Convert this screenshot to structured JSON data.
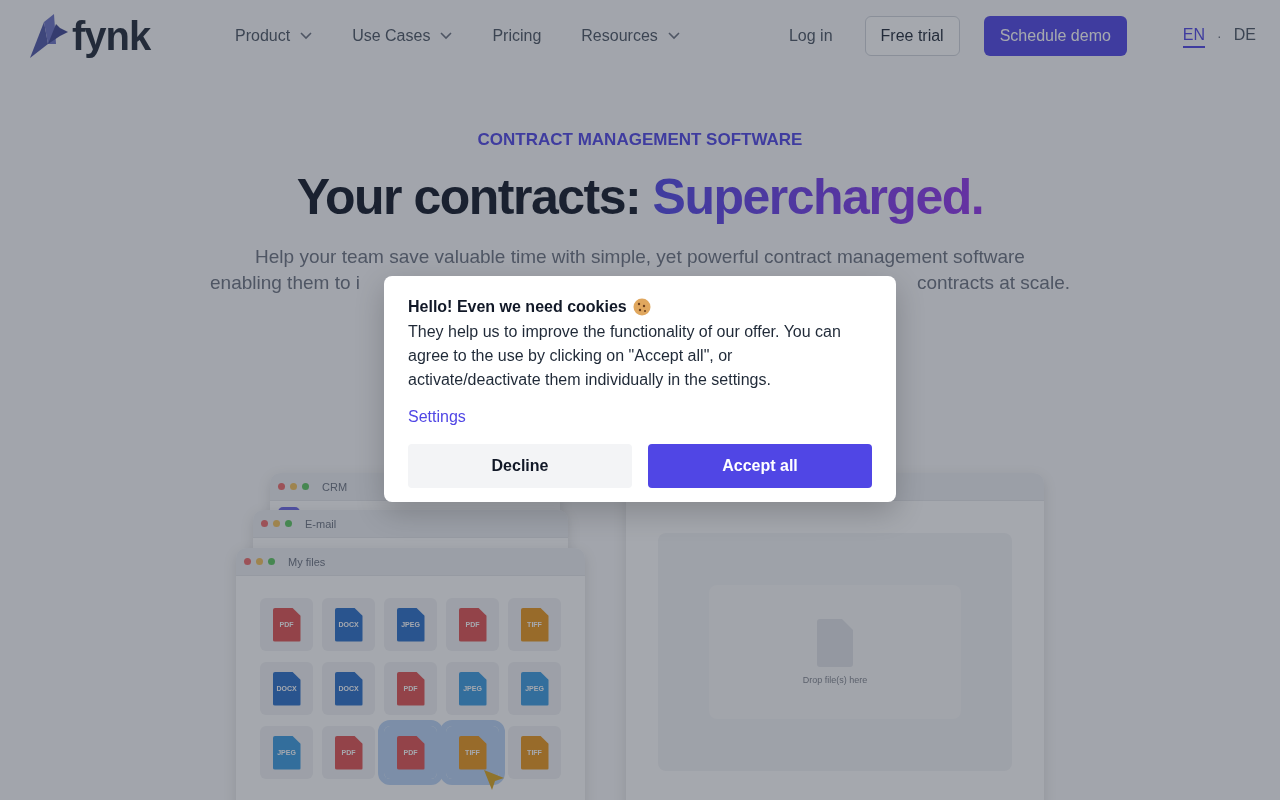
{
  "header": {
    "logo": "fynk",
    "nav": [
      {
        "label": "Product",
        "dropdown": true
      },
      {
        "label": "Use Cases",
        "dropdown": true
      },
      {
        "label": "Pricing",
        "dropdown": false
      },
      {
        "label": "Resources",
        "dropdown": true
      }
    ],
    "login": "Log in",
    "free_trial": "Free trial",
    "demo": "Schedule demo",
    "languages": [
      {
        "label": "EN",
        "selected": true
      },
      {
        "label": "DE",
        "selected": false
      }
    ],
    "language_separator": "·"
  },
  "hero": {
    "eyebrow": "CONTRACT MANAGEMENT SOFTWARE",
    "title": "Your contracts: ",
    "title_highlight": "Supercharged.",
    "line_1": "Help your team save valuable time with simple, yet powerful contract management software",
    "line_2_start": "enabling them to i",
    "line_2_end": "contracts at scale."
  },
  "mockup": {
    "crm": {
      "title": "CRM"
    },
    "email": {
      "title": "E-mail"
    },
    "files": {
      "title": "My files",
      "items": [
        {
          "type": "PDF",
          "kind": "pdf",
          "selected": false
        },
        {
          "type": "DOCX",
          "kind": "docx",
          "selected": false
        },
        {
          "type": "JPEG",
          "kind": "docx",
          "selected": false
        },
        {
          "type": "PDF",
          "kind": "pdf",
          "selected": false
        },
        {
          "type": "TIFF",
          "kind": "tiff",
          "selected": false
        },
        {
          "type": "DOCX",
          "kind": "docx",
          "selected": false
        },
        {
          "type": "DOCX",
          "kind": "docx",
          "selected": false
        },
        {
          "type": "PDF",
          "kind": "pdf",
          "selected": false
        },
        {
          "type": "JPEG",
          "kind": "jpeg",
          "selected": false
        },
        {
          "type": "JPEG",
          "kind": "jpeg",
          "selected": false
        },
        {
          "type": "JPEG",
          "kind": "jpeg",
          "selected": false
        },
        {
          "type": "PDF",
          "kind": "pdf",
          "selected": false
        },
        {
          "type": "PDF",
          "kind": "pdf",
          "selected": true
        },
        {
          "type": "TIFF",
          "kind": "tiff",
          "selected": true
        },
        {
          "type": "TIFF",
          "kind": "tiff",
          "selected": false
        }
      ]
    },
    "dropzone": "Drop file(s) here"
  },
  "cookie_dialog": {
    "title": "Hello! Even we need cookies",
    "text": "They help us to improve the functionality of our offer. You can agree to the use by clicking on \"Accept all\", or activate/deactivate them individually in the settings.",
    "settings": "Settings",
    "decline": "Decline",
    "accept": "Accept all"
  }
}
